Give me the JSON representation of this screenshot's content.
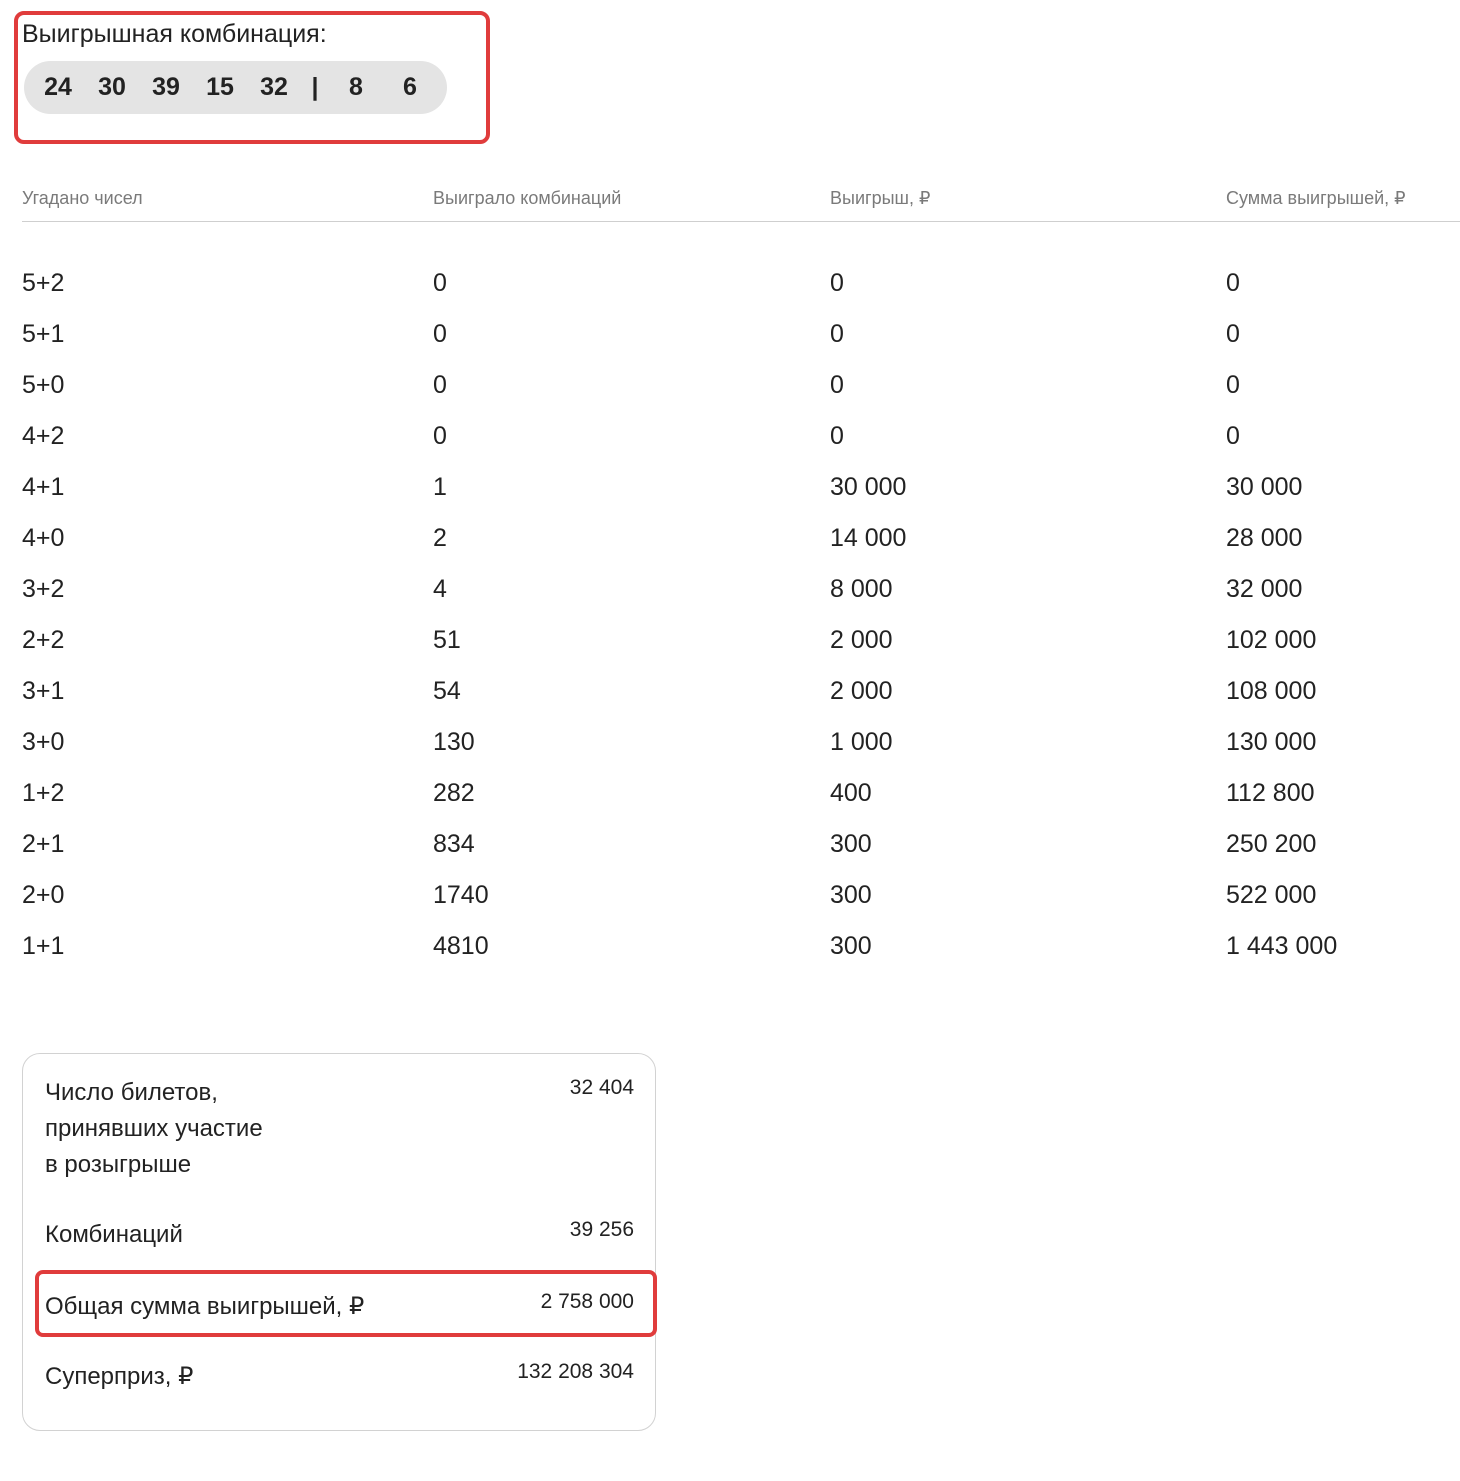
{
  "combination": {
    "title": "Выигрышная комбинация:",
    "numbers": [
      "24",
      "30",
      "39",
      "15",
      "32"
    ],
    "separator": "|",
    "bonus": [
      "8",
      "6"
    ]
  },
  "table": {
    "headers": [
      "Угадано чисел",
      "Выиграло комбинаций",
      "Выигрыш, ₽",
      "Сумма выигрышей, ₽"
    ],
    "rows": [
      [
        "5+2",
        "0",
        "0",
        "0"
      ],
      [
        "5+1",
        "0",
        "0",
        "0"
      ],
      [
        "5+0",
        "0",
        "0",
        "0"
      ],
      [
        "4+2",
        "0",
        "0",
        "0"
      ],
      [
        "4+1",
        "1",
        "30 000",
        "30 000"
      ],
      [
        "4+0",
        "2",
        "14 000",
        "28 000"
      ],
      [
        "3+2",
        "4",
        "8 000",
        "32 000"
      ],
      [
        "2+2",
        "51",
        "2 000",
        "102 000"
      ],
      [
        "3+1",
        "54",
        "2 000",
        "108 000"
      ],
      [
        "3+0",
        "130",
        "1 000",
        "130 000"
      ],
      [
        "1+2",
        "282",
        "400",
        "112 800"
      ],
      [
        "2+1",
        "834",
        "300",
        "250 200"
      ],
      [
        "2+0",
        "1740",
        "300",
        "522 000"
      ],
      [
        "1+1",
        "4810",
        "300",
        "1 443 000"
      ]
    ]
  },
  "summary": {
    "tickets_label_1": "Число билетов,",
    "tickets_label_2": "принявших участие",
    "tickets_label_3": "в розыгрыше",
    "tickets_value": "32 404",
    "combinations_label": "Комбинаций",
    "combinations_value": "39 256",
    "total_label": "Общая сумма выигрышей, ₽",
    "total_value": "2 758 000",
    "superprize_label": "Суперприз, ₽",
    "superprize_value": "132 208 304"
  },
  "colors": {
    "highlight": "#e03c3c",
    "ball_background": "#e4e4e4",
    "header_text": "#7a7a7a"
  }
}
